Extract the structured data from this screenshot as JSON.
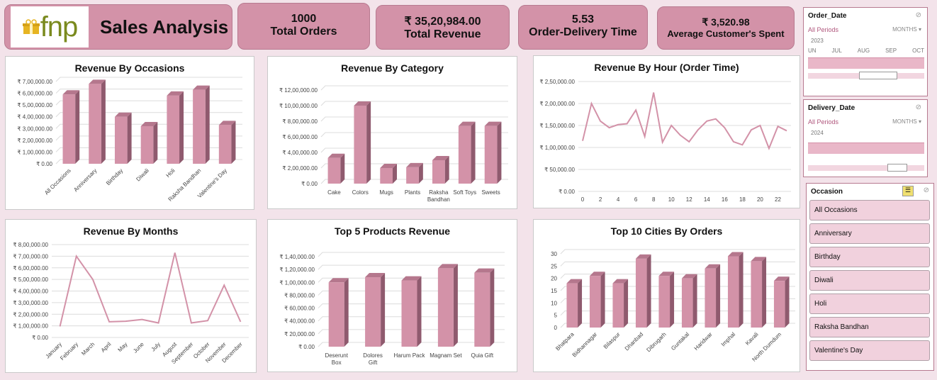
{
  "header": {
    "logo_text": "fnp",
    "title": "Sales Analysis"
  },
  "kpis": [
    {
      "value": "1000",
      "label": "Total Orders"
    },
    {
      "value": "₹ 35,20,984.00",
      "label": "Total Revenue"
    },
    {
      "value": "5.53",
      "label": "Order-Delivery Time"
    },
    {
      "value": "₹ 3,520.98",
      "label": "Average Customer's Spent"
    }
  ],
  "colors": {
    "bar_front": "#d392a8",
    "bar_side": "#8f5a6e",
    "bar_top": "#b5778d",
    "line": "#d392a8",
    "grid": "#dcdcdc"
  },
  "chart_data": [
    {
      "type": "bar",
      "title": "Revenue By Occasions",
      "categories": [
        "All Occasions",
        "Anniversary",
        "Birthday",
        "Diwali",
        "Holi",
        "Raksha Bandhan",
        "Valentine's Day"
      ],
      "values": [
        590000,
        680000,
        400000,
        320000,
        580000,
        630000,
        330000
      ],
      "ylim": [
        0,
        700000
      ],
      "yticks": [
        "₹ 0.00",
        "₹ 1,00,000.00",
        "₹ 2,00,000.00",
        "₹ 3,00,000.00",
        "₹ 4,00,000.00",
        "₹ 5,00,000.00",
        "₹ 6,00,000.00",
        "₹ 7,00,000.00"
      ]
    },
    {
      "type": "bar",
      "title": "Revenue By Category",
      "categories": [
        "Cake",
        "Colors",
        "Mugs",
        "Plants",
        "Raksha Bandhan",
        "Soft Toys",
        "Sweets"
      ],
      "values": [
        330000,
        1000000,
        200000,
        210000,
        300000,
        740000,
        740000
      ],
      "ylim": [
        0,
        1200000
      ],
      "yticks": [
        "₹ 0.00",
        "₹ 2,00,000.00",
        "₹ 4,00,000.00",
        "₹ 6,00,000.00",
        "₹ 8,00,000.00",
        "₹ 10,00,000.00",
        "₹ 12,00,000.00"
      ]
    },
    {
      "type": "line",
      "title": "Revenue By Hour (Order Time)",
      "x": [
        0,
        1,
        2,
        3,
        4,
        5,
        6,
        7,
        8,
        9,
        10,
        11,
        12,
        13,
        14,
        15,
        16,
        17,
        18,
        19,
        20,
        21,
        22,
        23
      ],
      "values": [
        115000,
        200000,
        160000,
        145000,
        152000,
        154000,
        185000,
        125000,
        225000,
        112000,
        150000,
        128000,
        113000,
        140000,
        160000,
        165000,
        145000,
        113000,
        106000,
        140000,
        150000,
        98000,
        148000,
        138000
      ],
      "ylim": [
        0,
        250000
      ],
      "xticks": [
        "0",
        "2",
        "4",
        "6",
        "8",
        "10",
        "12",
        "14",
        "16",
        "18",
        "20",
        "22"
      ],
      "yticks": [
        "₹ 0.00",
        "₹ 50,000.00",
        "₹ 1,00,000.00",
        "₹ 1,50,000.00",
        "₹ 2,00,000.00",
        "₹ 2,50,000.00"
      ]
    },
    {
      "type": "line",
      "title": "Revenue By Months",
      "categories": [
        "January",
        "February",
        "March",
        "April",
        "May",
        "June",
        "July",
        "August",
        "September",
        "October",
        "November",
        "December"
      ],
      "values": [
        95000,
        700000,
        500000,
        135000,
        140000,
        155000,
        125000,
        730000,
        125000,
        145000,
        450000,
        135000
      ],
      "ylim": [
        0,
        800000
      ],
      "yticks": [
        "₹ 0.00",
        "₹ 1,00,000.00",
        "₹ 2,00,000.00",
        "₹ 3,00,000.00",
        "₹ 4,00,000.00",
        "₹ 5,00,000.00",
        "₹ 6,00,000.00",
        "₹ 7,00,000.00",
        "₹ 8,00,000.00"
      ]
    },
    {
      "type": "bar",
      "title": "Top 5 Products Revenue",
      "categories": [
        "Deserunt Box",
        "Dolores Gift",
        "Harum Pack",
        "Magnam Set",
        "Quia Gift"
      ],
      "values": [
        100000,
        108000,
        103000,
        122000,
        115000
      ],
      "ylim": [
        0,
        140000
      ],
      "yticks": [
        "₹ 0.00",
        "₹ 20,000.00",
        "₹ 40,000.00",
        "₹ 60,000.00",
        "₹ 80,000.00",
        "₹ 1,00,000.00",
        "₹ 1,20,000.00",
        "₹ 1,40,000.00"
      ]
    },
    {
      "type": "bar",
      "title": "Top 10 Cities By Orders",
      "categories": [
        "Bhatpara",
        "Bidhannagar",
        "Bilaspur",
        "Dhanbad",
        "Dibrugarh",
        "Guntakal",
        "Haridwar",
        "Imphal",
        "Kavali",
        "North Dumdum"
      ],
      "values": [
        18,
        21,
        18,
        28,
        21,
        20,
        24,
        29,
        27,
        19
      ],
      "ylim": [
        0,
        30
      ],
      "yticks": [
        "0",
        "5",
        "10",
        "15",
        "20",
        "25",
        "30"
      ]
    }
  ],
  "slicers": {
    "order_date": {
      "title": "Order_Date",
      "period": "All Periods",
      "mode": "MONTHS",
      "year": "2023",
      "months": [
        "UN",
        "JUL",
        "AUG",
        "SEP",
        "OCT"
      ]
    },
    "delivery_date": {
      "title": "Delivery_Date",
      "period": "All Periods",
      "mode": "MONTHS",
      "year": "2024"
    },
    "occasion": {
      "title": "Occasion",
      "items": [
        "All Occasions",
        "Anniversary",
        "Birthday",
        "Diwali",
        "Holi",
        "Raksha Bandhan",
        "Valentine's Day"
      ]
    }
  }
}
